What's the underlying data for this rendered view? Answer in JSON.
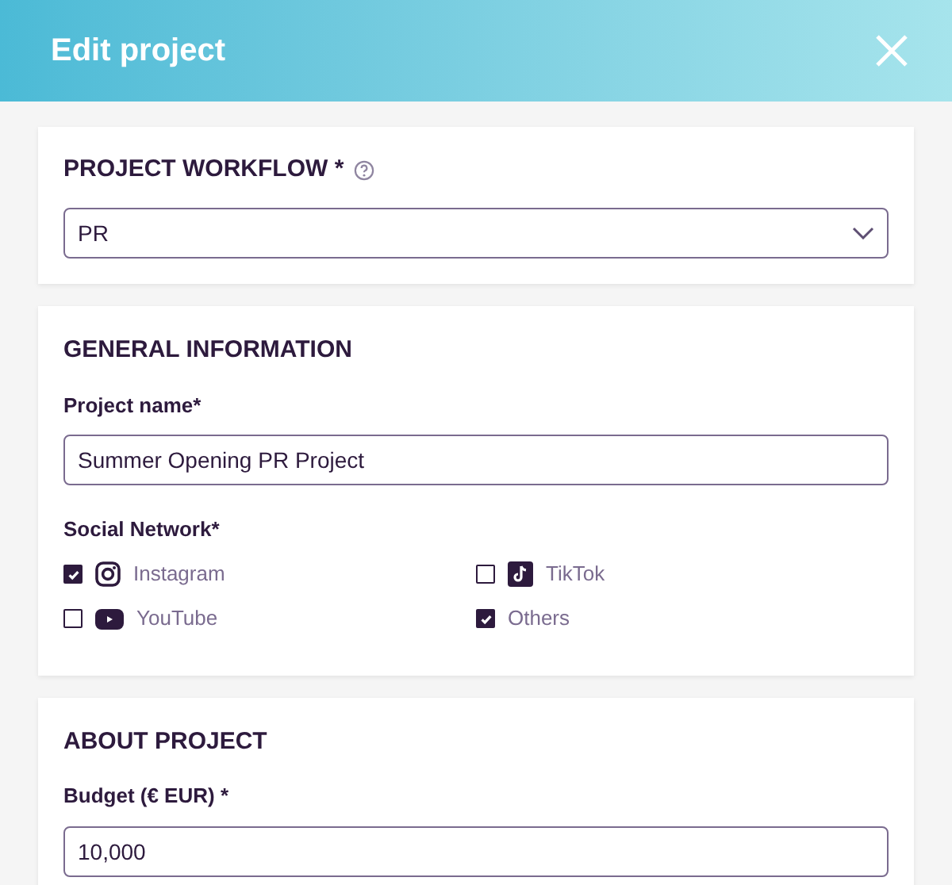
{
  "dialog": {
    "title": "Edit project"
  },
  "workflow": {
    "heading": "PROJECT WORKFLOW *",
    "value": "PR"
  },
  "general": {
    "heading": "GENERAL INFORMATION",
    "project_name_label": "Project name*",
    "project_name": "Summer Opening PR Project",
    "social_label": "Social Network*",
    "networks": [
      {
        "label": "Instagram",
        "kind": "instagram",
        "checked": true
      },
      {
        "label": "TikTok",
        "kind": "tiktok",
        "checked": false
      },
      {
        "label": "YouTube",
        "kind": "youtube",
        "checked": false
      },
      {
        "label": "Others",
        "kind": "plain",
        "checked": true
      }
    ]
  },
  "about": {
    "heading": "ABOUT PROJECT",
    "budget_label": "Budget (€ EUR) *",
    "budget": "10,000"
  }
}
